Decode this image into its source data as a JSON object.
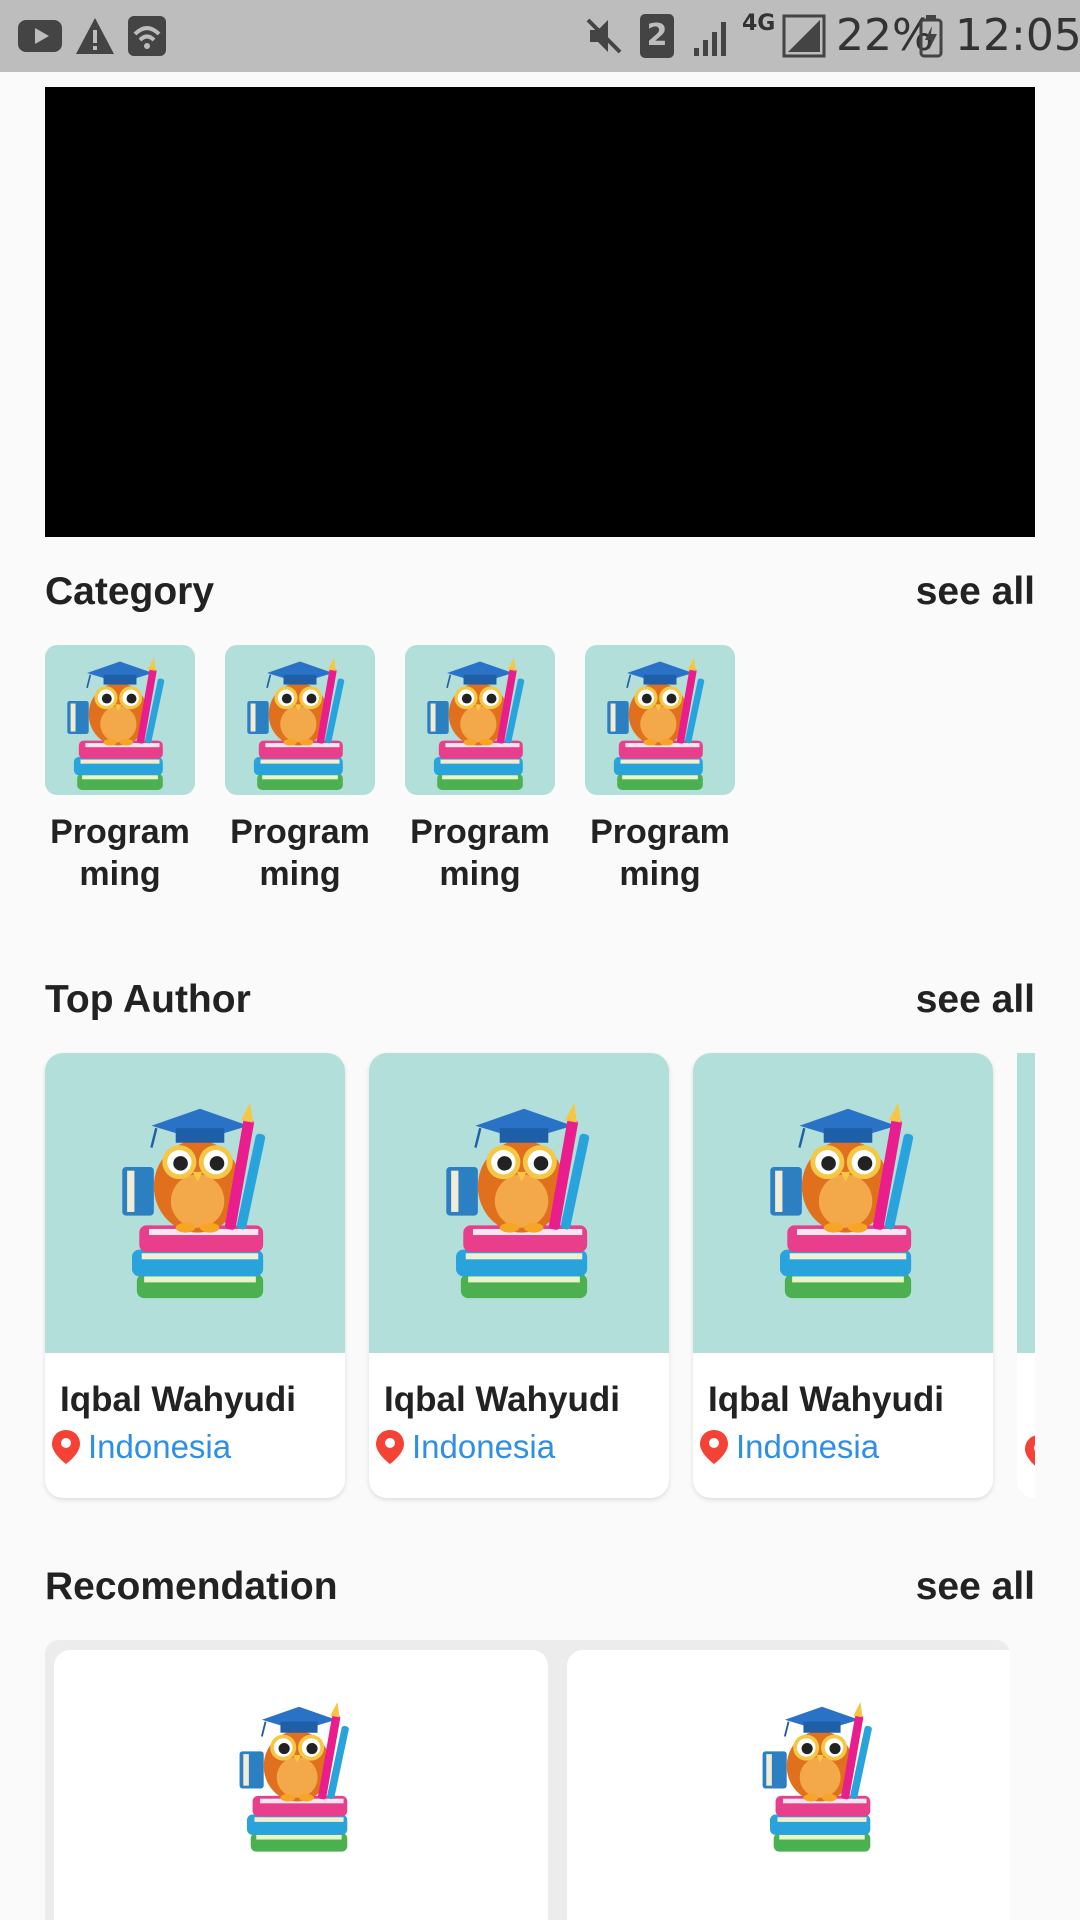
{
  "status_bar": {
    "sim": "2",
    "network": "4G",
    "battery": "22%",
    "time": "12:05"
  },
  "category": {
    "title": "Category",
    "see_all": "see all",
    "items": [
      {
        "label": "Program ming"
      },
      {
        "label": "Program ming"
      },
      {
        "label": "Program ming"
      },
      {
        "label": "Program ming"
      }
    ]
  },
  "top_author": {
    "title": "Top Author",
    "see_all": "see all",
    "authors": [
      {
        "name": "Iqbal Wahyudi",
        "location": "Indonesia"
      },
      {
        "name": "Iqbal Wahyudi",
        "location": "Indonesia"
      },
      {
        "name": "Iqbal Wahyudi",
        "location": "Indonesia"
      }
    ]
  },
  "recommendation": {
    "title": "Recomendation",
    "see_all": "see all"
  },
  "colors": {
    "thumb_bg": "#b3dfdb",
    "link_blue": "#2f8fe6",
    "pin_red": "#f44336",
    "status_bar": "#bdbdbd"
  }
}
